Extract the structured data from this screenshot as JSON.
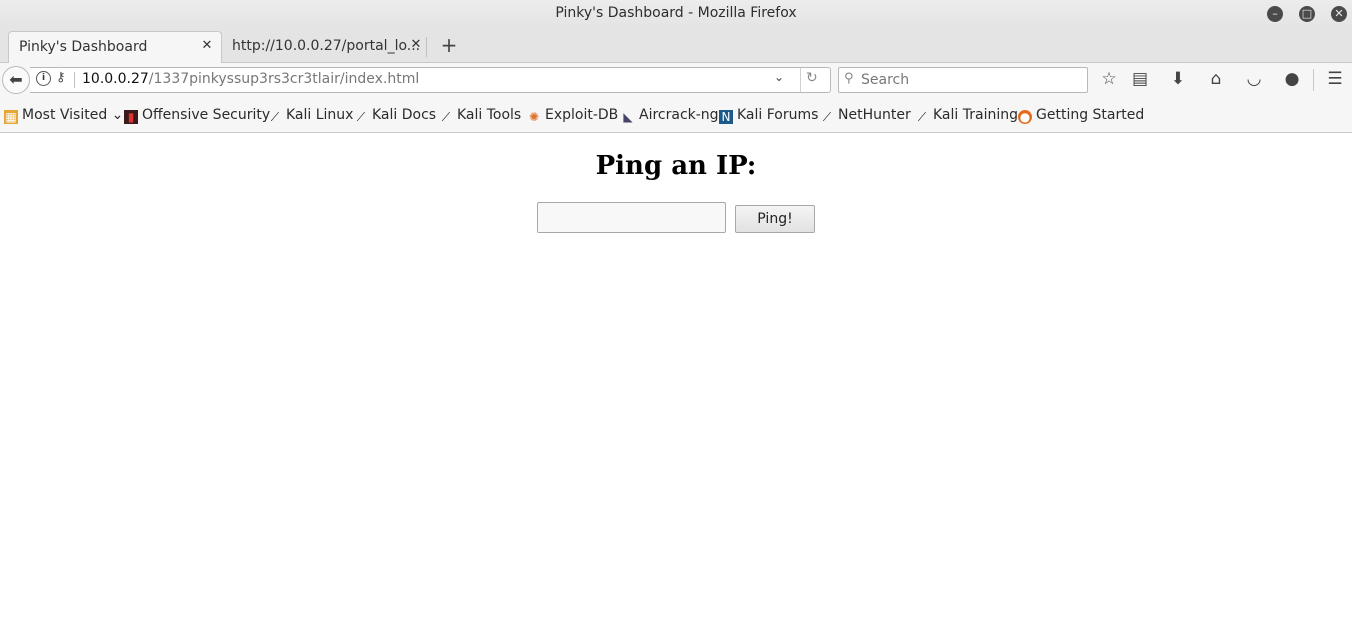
{
  "window": {
    "title": "Pinky's Dashboard - Mozilla Firefox",
    "controls": {
      "minimize": "–",
      "maximize": "□",
      "close": "✕"
    }
  },
  "tabs": [
    {
      "label": "Pinky's Dashboard",
      "active": true
    },
    {
      "label": "http://10.0.0.27/portal_lo...",
      "active": false
    }
  ],
  "new_tab_label": "+",
  "navbar": {
    "url_host": "10.0.0.27",
    "url_path": "/1337pinkyssup3rs3cr3tlair/index.html",
    "search_placeholder": "Search",
    "icons": [
      "back-icon",
      "info-icon",
      "key-icon",
      "dropdown-icon",
      "reload-icon",
      "search-icon",
      "star-icon",
      "reading-list-icon",
      "download-icon",
      "home-icon",
      "pocket-icon",
      "cookie-icon",
      "menu-icon"
    ]
  },
  "bookmarks": [
    {
      "label": "Most Visited",
      "icon": "folder-icon"
    },
    {
      "label": "Offensive Security",
      "icon": "offsec-icon"
    },
    {
      "label": "Kali Linux",
      "icon": "kali-dragon-icon"
    },
    {
      "label": "Kali Docs",
      "icon": "kali-dragon-icon"
    },
    {
      "label": "Kali Tools",
      "icon": "kali-dragon-icon"
    },
    {
      "label": "Exploit-DB",
      "icon": "exploit-db-icon"
    },
    {
      "label": "Aircrack-ng",
      "icon": "aircrack-icon"
    },
    {
      "label": "Kali Forums",
      "icon": "kali-forums-icon"
    },
    {
      "label": "NetHunter",
      "icon": "kali-dragon-icon"
    },
    {
      "label": "Kali Training",
      "icon": "kali-dragon-icon"
    },
    {
      "label": "Getting Started",
      "icon": "firefox-icon"
    }
  ],
  "page": {
    "heading": "Ping an IP:",
    "ip_input_value": "",
    "ping_button": "Ping!"
  }
}
